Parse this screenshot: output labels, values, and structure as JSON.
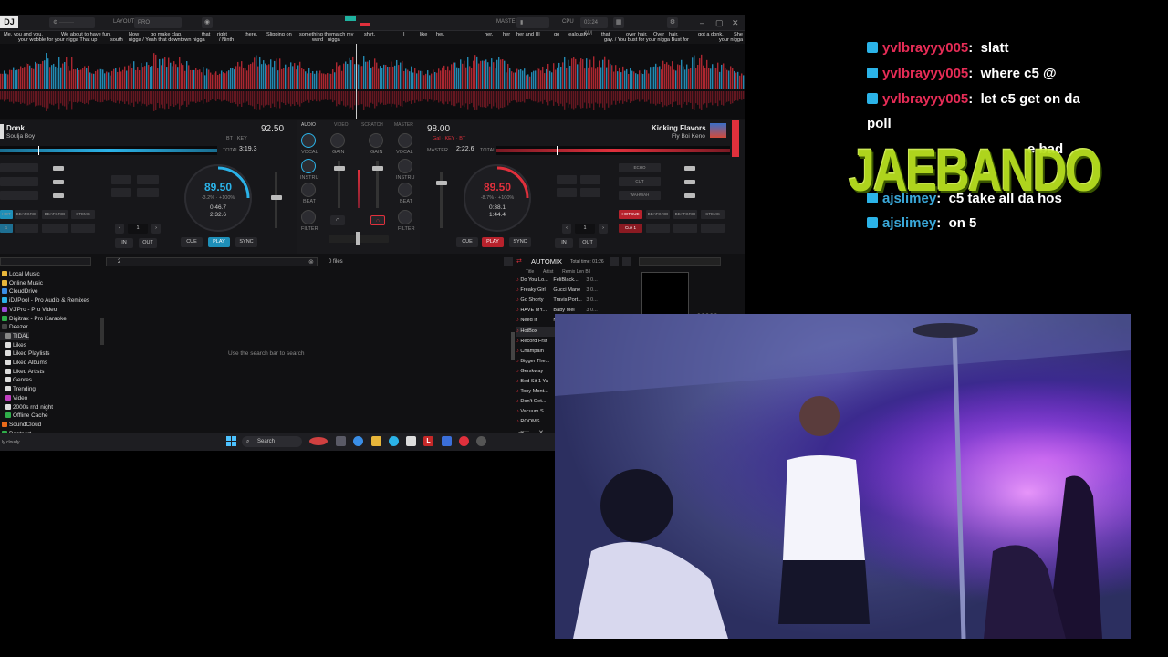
{
  "titlebar": {
    "logo": "DJ",
    "layout_label": "LAYOUT",
    "layout_value": "PRO",
    "master_label": "MASTER",
    "cpu_label": "CPU",
    "clock": "03:24 AM"
  },
  "lyrics": [
    "Me,   you and you.",
    "We about to have fun.",
    "Now",
    "go make clap,",
    "that",
    "right",
    "there.",
    "Slipping on",
    "something thematch my",
    "shirt.",
    "I",
    "like",
    "her,",
    "her,",
    "her",
    "her and I'll",
    "go",
    "jealously",
    "that",
    "over",
    "hair.",
    "Over",
    "hair.",
    "got a donk.",
    "She",
    "your wobble for your nigga That up",
    "south",
    "nigga / Yeah that downtown nigga",
    "/ Ninth",
    "ward",
    "nigga",
    "gay. / You bust for your nigga Bust for",
    "your nigga"
  ],
  "deck_left": {
    "title": "Donk",
    "artist": "Soulja Boy",
    "bpm": "92.50",
    "time_total": "3:19.3",
    "jog_bpm": "89.50",
    "jog_pitch": "-3.2%",
    "jog_percent": "+100%",
    "jog_elapsed": "0:46.7",
    "jog_remain": "2:32.6",
    "buttons": [
      "CUE",
      "PLAY",
      "SYNC",
      "IN",
      "OUT"
    ],
    "loop_value": "1"
  },
  "deck_right": {
    "title": "Kicking Flavors",
    "artist": "Fly Boi Keno",
    "bpm": "98.00",
    "time_total": "2:22.6",
    "jog_bpm": "89.50",
    "jog_pitch": "-8.7%",
    "jog_percent": "+100%",
    "jog_elapsed": "0:38.1",
    "jog_remain": "1:44.4",
    "buttons": [
      "CUE",
      "PLAY",
      "SYNC",
      "IN",
      "OUT"
    ],
    "loop_value": "1",
    "cue_label": "Cue 1"
  },
  "mixer": {
    "tabs": [
      "AUDIO",
      "VIDEO",
      "SCRATCH",
      "MASTER"
    ],
    "labels": [
      "VOCAL",
      "GAIN",
      "GAIN",
      "VOCAL",
      "INSTRU",
      "INSTRU",
      "BEAT",
      "BEAT",
      "FILTER",
      "FILTER"
    ]
  },
  "browser": {
    "tree": [
      "Local Music",
      "Online Music",
      "CloudDrive",
      "iDJPool - Pro Audio & Remixes",
      "VJ'Pro - Pro Video",
      "Digitrax - Pro Karaoke",
      "Deezer",
      "TIDAL",
      "Likes",
      "Liked Playlists",
      "Liked Albums",
      "Liked Artists",
      "Genres",
      "Trending",
      "Video",
      "2000s rnd night",
      "Offline Cache",
      "SoundCloud",
      "Beatport",
      "Offline Cache"
    ],
    "search_value": "2",
    "files_count": "0 files",
    "empty_hint": "Use the search bar to search"
  },
  "automix": {
    "title": "AUTOMIX",
    "total_time": "Total time: 01:26",
    "columns": [
      "Title",
      "Artist",
      "Remix",
      "Len",
      "Bll"
    ],
    "rows": [
      {
        "title": "Do You Lo...",
        "artist": "FeliBlack..."
      },
      {
        "title": "Freaky Girl",
        "artist": "Gucci Mane"
      },
      {
        "title": "Go Shorty",
        "artist": "Travis Port..."
      },
      {
        "title": "HAVE MY...",
        "artist": "Baby Mel"
      },
      {
        "title": "Need It",
        "artist": "Migos"
      },
      {
        "title": "HotBox",
        "artist": ""
      },
      {
        "title": "Record Frst",
        "artist": ""
      },
      {
        "title": "Champain",
        "artist": ""
      },
      {
        "title": "Bigger The...",
        "artist": ""
      },
      {
        "title": "Gerskway",
        "artist": ""
      },
      {
        "title": "Bed Sit 1 Ya",
        "artist": ""
      },
      {
        "title": "Tony Mont...",
        "artist": ""
      },
      {
        "title": "Don't Get...",
        "artist": ""
      },
      {
        "title": "Vacuum S...",
        "artist": ""
      },
      {
        "title": "ROOMS",
        "artist": ""
      }
    ]
  },
  "taskbar": {
    "search_label": "Search",
    "weather": "ly cloudy"
  },
  "chat": [
    {
      "user": "yvlbrayyy005",
      "message": "slatt"
    },
    {
      "user": "yvlbrayyy005",
      "message": "where c5 @"
    },
    {
      "user": "yvlbrayyy005",
      "message": "let c5 get on da"
    },
    {
      "user": "",
      "message": "poll"
    },
    {
      "user": "",
      "message": "e bad"
    },
    {
      "user": "ajslimey",
      "message": "c5 take all da hos"
    },
    {
      "user": "ajslimey",
      "message": "on 5"
    }
  ],
  "overlay_logo": "JAEBANDO",
  "colors": {
    "deck_left_accent": "#2bb3e8",
    "deck_right_accent": "#e0303c",
    "chat_user": "#e62c56",
    "chat_user2": "#3aa8d9",
    "logo_green": "#b8e01f"
  }
}
